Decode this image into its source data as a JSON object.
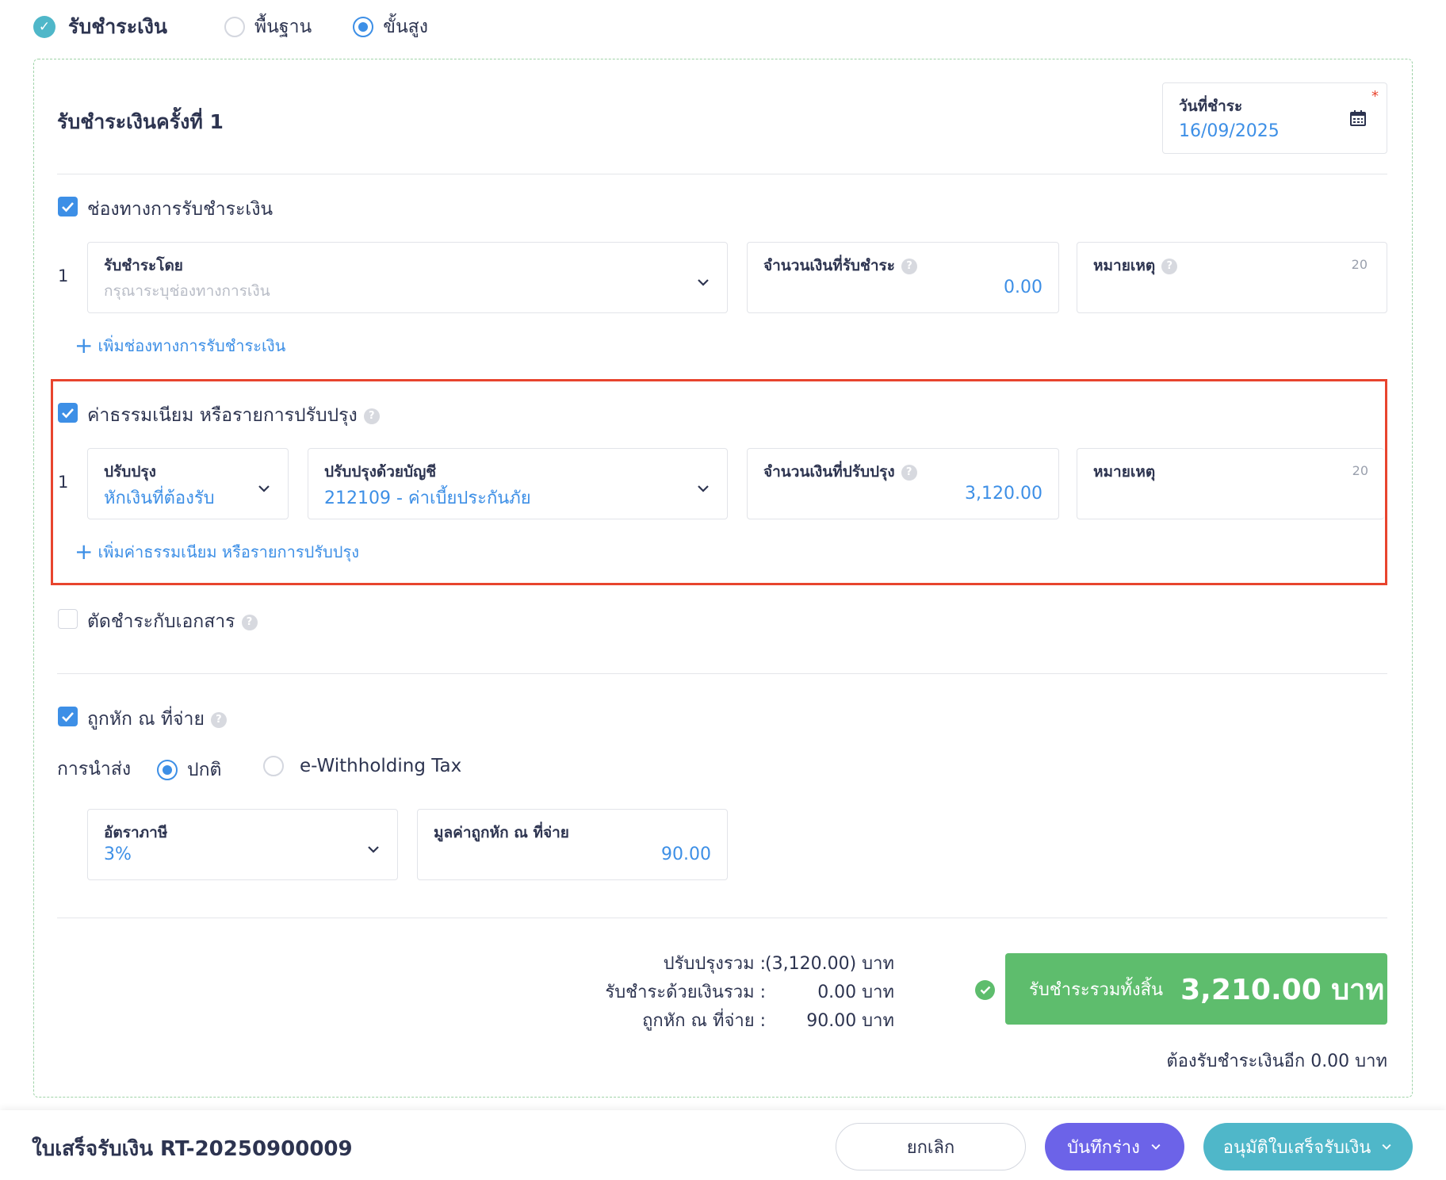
{
  "header": {
    "title": "รับชำระเงิน",
    "mode_basic": "พื้นฐาน",
    "mode_advanced": "ขั้นสูง",
    "selected_mode": "advanced"
  },
  "payment": {
    "section_title": "รับชำระเงินครั้งที่ 1",
    "date_label": "วันที่ชำระ",
    "date_value": "16/09/2025",
    "required_mark": "*"
  },
  "channels": {
    "checkbox_label": "ช่องทางการรับชำระเงิน",
    "checked": true,
    "rows": [
      {
        "num": "1",
        "method_label": "รับชำระโดย",
        "method_placeholder": "กรุณาระบุช่องทางการเงิน",
        "amount_label": "จำนวนเงินที่รับชำระ",
        "amount_value": "0.00",
        "note_label": "หมายเหตุ",
        "note_counter": "20"
      }
    ],
    "add_label": "เพิ่มช่องทางการรับชำระเงิน"
  },
  "fees": {
    "checkbox_label": "ค่าธรรมเนียม หรือรายการปรับปรุง",
    "checked": true,
    "rows": [
      {
        "num": "1",
        "adjust_label": "ปรับปรุง",
        "adjust_value": "หักเงินที่ต้องรับ",
        "account_label": "ปรับปรุงด้วยบัญชี",
        "account_value": "212109 - ค่าเบี้ยประกันภัย",
        "amount_label": "จำนวนเงินที่ปรับปรุง",
        "amount_value": "3,120.00",
        "note_label": "หมายเหตุ",
        "note_counter": "20"
      }
    ],
    "add_label": "เพิ่มค่าธรรมเนียม หรือรายการปรับปรุง"
  },
  "offset": {
    "checkbox_label": "ตัดชำระกับเอกสาร",
    "checked": false
  },
  "withholding": {
    "checkbox_label": "ถูกหัก ณ ที่จ่าย",
    "checked": true,
    "submit_label": "การนำส่ง",
    "option_normal": "ปกติ",
    "option_etax": "e-Withholding Tax",
    "selected_option": "normal",
    "rate_label": "อัตราภาษี",
    "rate_value": "3%",
    "value_label": "มูลค่าถูกหัก ณ ที่จ่าย",
    "value_amount": "90.00"
  },
  "summary": {
    "adjust_label": "ปรับปรุงรวม :",
    "adjust_value": "(3,120.00) บาท",
    "cash_label": "รับชำระด้วยเงินรวม :",
    "cash_value": "0.00 บาท",
    "wht_label": "ถูกหัก ณ ที่จ่าย :",
    "wht_value": "90.00 บาท",
    "total_label": "รับชำระรวมทั้งสิ้น",
    "total_amount": "3,210.00 บาท",
    "remaining": "ต้องรับชำระเงินอีก 0.00 บาท"
  },
  "footer": {
    "doc_title": "ใบเสร็จรับเงิน RT-20250900009",
    "cancel_label": "ยกเลิก",
    "draft_label": "บันทึกร่าง",
    "approve_label": "อนุมัติใบเสร็จรับเงิน"
  },
  "colors": {
    "accent": "#3d8fe6",
    "teal": "#4fb7c9",
    "success": "#5ebd6d",
    "draft": "#6c63e8",
    "highlight": "#e8442e"
  }
}
